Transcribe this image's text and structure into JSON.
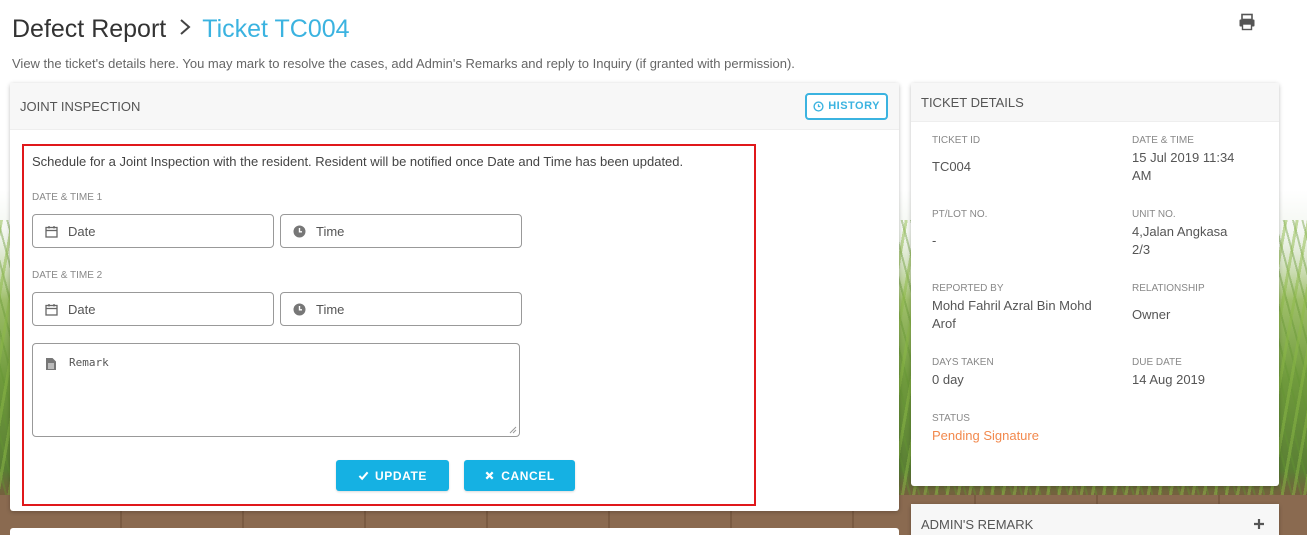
{
  "header": {
    "breadcrumb_root": "Defect Report",
    "breadcrumb_current": "Ticket TC004",
    "description": "View the ticket's details here. You may mark to resolve the cases, add Admin's Remarks and reply to Inquiry (if granted with permission)."
  },
  "joint_inspection": {
    "title": "JOINT INSPECTION",
    "history_label": "HISTORY",
    "intro": "Schedule for a Joint Inspection with the resident. Resident will be notified once Date and Time has been updated.",
    "slot1_label": "DATE & TIME 1",
    "slot2_label": "DATE & TIME 2",
    "date_placeholder": "Date",
    "time_placeholder": "Time",
    "remark_placeholder": "Remark",
    "update_label": "UPDATE",
    "cancel_label": "CANCEL"
  },
  "ticket_details": {
    "title": "TICKET DETAILS",
    "ticket_id_label": "TICKET ID",
    "ticket_id": "TC004",
    "datetime_label": "DATE & TIME",
    "datetime_line1": "15 Jul 2019 11:34",
    "datetime_line2": "AM",
    "ptlot_label": "PT/LOT NO.",
    "ptlot": "-",
    "unit_label": "UNIT NO.",
    "unit_line1": "4,Jalan Angkasa",
    "unit_line2": "2/3",
    "reported_by_label": "REPORTED BY",
    "reported_by_line1": "Mohd Fahril Azral Bin Mohd",
    "reported_by_line2": "Arof",
    "relationship_label": "RELATIONSHIP",
    "relationship": "Owner",
    "days_taken_label": "DAYS TAKEN",
    "days_taken": "0 day",
    "due_date_label": "DUE DATE",
    "due_date": "14 Aug 2019",
    "status_label": "STATUS",
    "status": "Pending Signature"
  },
  "admin_remark": {
    "title": "ADMIN'S REMARK"
  },
  "colors": {
    "accent": "#15b1e3",
    "link": "#3bb3e0",
    "highlight_border": "#e0181b",
    "status": "#f2894d"
  },
  "icons": {
    "print": "print-icon",
    "history": "clock-icon",
    "date": "calendar-icon",
    "time": "clock-icon",
    "remark": "document-icon",
    "update": "check-icon",
    "cancel": "close-icon",
    "expand": "plus-icon"
  }
}
